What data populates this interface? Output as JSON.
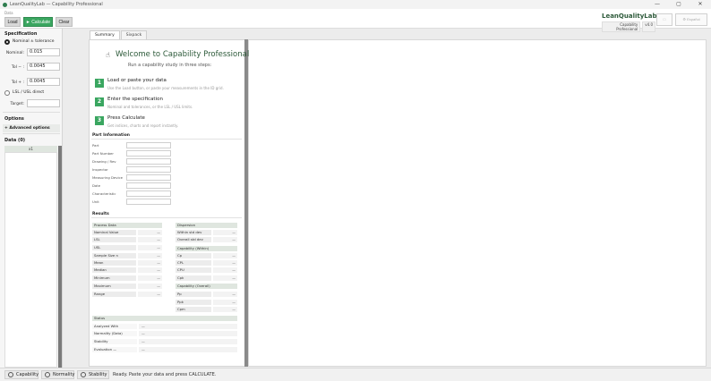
{
  "window": {
    "title": "LeanQualityLab — Capability Professional",
    "controls": [
      "—",
      "▢",
      "✕"
    ]
  },
  "toolbar": {
    "data_label": "Data",
    "load": "Load",
    "calculate": "► Calculate",
    "clear": "Clear"
  },
  "brand": {
    "name": "LeanQualityLab",
    "product": "Capability Professional",
    "version": "v4.0",
    "header_btn1": "□",
    "header_btn2": "⚙ Español"
  },
  "spec": {
    "heading": "Specification",
    "mode_nominal": "Nominal ± tolerance",
    "nominal_label": "Nominal:",
    "nominal_value": "0.015",
    "tol_minus_label": "Tol − :",
    "tol_minus_value": "0.0045",
    "tol_plus_label": "Tol + :",
    "tol_plus_value": "0.0045",
    "mode_direct": "LSL / USL direct",
    "target_label": "Target:",
    "target_value": ""
  },
  "options": {
    "heading": "Options",
    "advanced": "+ Advanced options"
  },
  "data_grid": {
    "heading": "Data (0)",
    "column": "x1"
  },
  "tabs": [
    "Summary",
    "Sixpack"
  ],
  "welcome": {
    "title": "Welcome to Capability Professional",
    "subtitle": "Run a capability study in three steps:",
    "steps": [
      {
        "num": "1",
        "title": "Load or paste your data",
        "desc": "Use the Load button, or paste your measurements in the ID grid."
      },
      {
        "num": "2",
        "title": "Enter the specification",
        "desc": "Nominal and tolerances, or the LSL / USL limits."
      },
      {
        "num": "3",
        "title": "Press Calculate",
        "desc": "Get indices, charts and report instantly."
      }
    ]
  },
  "part_info": {
    "heading": "Part Information",
    "fields": [
      "Part",
      "Part Number",
      "Drawing / Rev",
      "Inspector",
      "Measuring Device",
      "Date",
      "Characteristic",
      "Unit"
    ]
  },
  "results": {
    "heading": "Results",
    "process_hdr": "Process Data",
    "process": [
      {
        "label": "Nominal Value",
        "value": "—"
      },
      {
        "label": "LSL",
        "value": "—"
      },
      {
        "label": "USL",
        "value": "—"
      },
      {
        "label": "Sample Size n",
        "value": "—"
      },
      {
        "label": "Mean",
        "value": "—"
      },
      {
        "label": "Median",
        "value": "—"
      },
      {
        "label": "Minimum",
        "value": "—"
      },
      {
        "label": "Maximum",
        "value": "—"
      },
      {
        "label": "Range",
        "value": "—"
      }
    ],
    "dispersion_hdr": "Dispersion",
    "dispersion": [
      {
        "label": "Within std dev",
        "value": "—"
      },
      {
        "label": "Overall std dev",
        "value": "—"
      }
    ],
    "within_hdr": "Capability (Within)",
    "within": [
      {
        "label": "Cp",
        "value": "—"
      },
      {
        "label": "CPL",
        "value": "—"
      },
      {
        "label": "CPU",
        "value": "—"
      },
      {
        "label": "Cpk",
        "value": "—"
      }
    ],
    "overall_hdr": "Capability (Overall)",
    "overall": [
      {
        "label": "Pp",
        "value": "—"
      },
      {
        "label": "Ppk",
        "value": "—"
      },
      {
        "label": "Cpm",
        "value": "—"
      }
    ]
  },
  "status_section": {
    "heading": "Status",
    "rows": [
      {
        "label": "Analyzed With",
        "value": "—"
      },
      {
        "label": "Normality (Data)",
        "value": "—"
      },
      {
        "label": "Stability",
        "value": "—"
      },
      {
        "label": "Evaluation —",
        "value": "—"
      }
    ]
  },
  "bottom": {
    "tab1": "Capability",
    "tab2": "Normality",
    "tab3": "Stability",
    "status": "Ready. Paste your data and press CALCULATE."
  }
}
